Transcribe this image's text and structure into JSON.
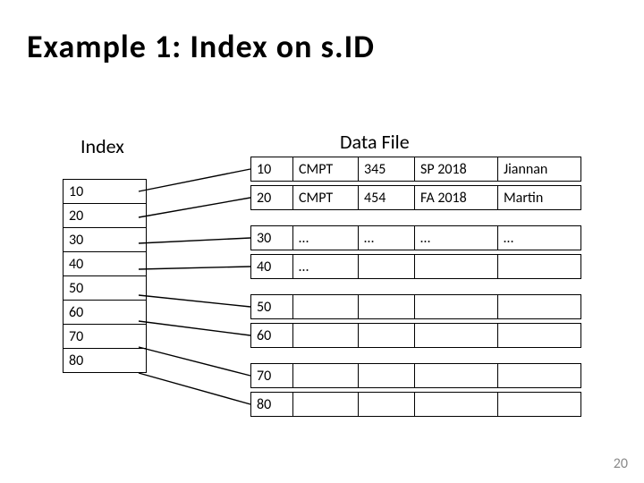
{
  "title": "Example  1:   Index  on  s.ID",
  "index_label": "Index",
  "data_label": "Data  File",
  "index_rows": [
    "10",
    "20",
    "30",
    "40",
    "50",
    "60",
    "70",
    "80"
  ],
  "data_rows": [
    {
      "c0": "10",
      "c1": "CMPT",
      "c2": "345",
      "c3": "SP 2018",
      "c4": "Jiannan"
    },
    {
      "c0": "20",
      "c1": "CMPT",
      "c2": "454",
      "c3": "FA 2018",
      "c4": "Martin"
    },
    {
      "c0": "30",
      "c1": "…",
      "c2": "…",
      "c3": "…",
      "c4": "…"
    },
    {
      "c0": "40",
      "c1": "…",
      "c2": "",
      "c3": "",
      "c4": ""
    },
    {
      "c0": "50",
      "c1": "",
      "c2": "",
      "c3": "",
      "c4": ""
    },
    {
      "c0": "60",
      "c1": "",
      "c2": "",
      "c3": "",
      "c4": ""
    },
    {
      "c0": "70",
      "c1": "",
      "c2": "",
      "c3": "",
      "c4": ""
    },
    {
      "c0": "80",
      "c1": "",
      "c2": "",
      "c3": "",
      "c4": ""
    }
  ],
  "page_number": "20"
}
